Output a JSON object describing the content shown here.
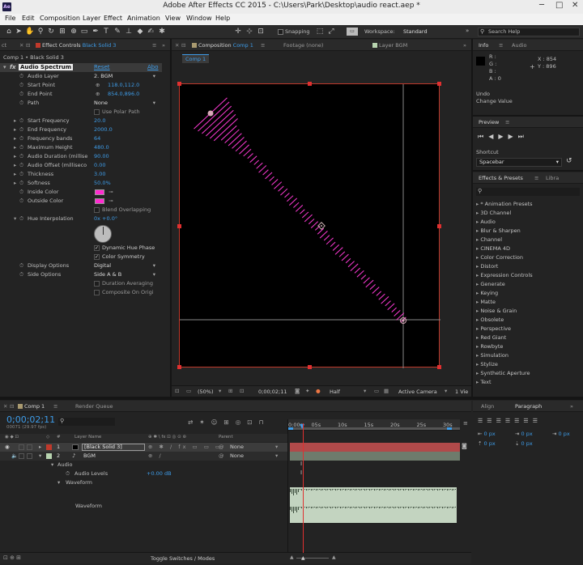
{
  "window": {
    "title": "Adobe After Effects CC 2015 - C:\\Users\\Park\\Desktop\\audio react.aep *",
    "app_icon": "Ae"
  },
  "menu": [
    "File",
    "Edit",
    "Composition",
    "Layer",
    "Effect",
    "Animation",
    "View",
    "Window",
    "Help"
  ],
  "toolbar": {
    "snapping_label": "Snapping",
    "workspace_label": "Workspace:",
    "workspace_value": "Standard",
    "search_placeholder": "Search Help"
  },
  "effect_controls": {
    "tab_prev": "ct",
    "tab_label": "Effect Controls",
    "tab_layer": "Black Solid 3",
    "breadcrumb": "Comp 1 • Black Solid 3",
    "effect_name": "Audio Spectrum",
    "reset_label": "Reset",
    "about_label": "Abo",
    "rows": [
      {
        "label": "Audio Layer",
        "value": "2. BGM",
        "type": "dropdown"
      },
      {
        "label": "Start Point",
        "value": "118.0,112.0",
        "type": "point"
      },
      {
        "label": "End Point",
        "value": "854.0,896.0",
        "type": "point"
      },
      {
        "label": "Path",
        "value": "None",
        "type": "dropdown"
      },
      {
        "label": "",
        "value": "Use Polar Path",
        "type": "check"
      },
      {
        "label": "Start Frequency",
        "value": "20.0",
        "type": "num"
      },
      {
        "label": "End Frequency",
        "value": "2000.0",
        "type": "num"
      },
      {
        "label": "Frequency bands",
        "value": "64",
        "type": "num"
      },
      {
        "label": "Maximum Height",
        "value": "480.0",
        "type": "num"
      },
      {
        "label": "Audio Duration (millise",
        "value": "90.00",
        "type": "num"
      },
      {
        "label": "Audio Offset (milliseco",
        "value": "0.00",
        "type": "num"
      },
      {
        "label": "Thickness",
        "value": "3.00",
        "type": "num"
      },
      {
        "label": "Softness",
        "value": "50.0%",
        "type": "num"
      },
      {
        "label": "Inside Color",
        "value": "",
        "type": "color"
      },
      {
        "label": "Outside Color",
        "value": "",
        "type": "color"
      },
      {
        "label": "",
        "value": "Blend Overlapping",
        "type": "check"
      },
      {
        "label": "Hue Interpolation",
        "value": "0x +0.0°",
        "type": "num"
      },
      {
        "label": "",
        "value": "Dynamic Hue Phase",
        "type": "check-on"
      },
      {
        "label": "",
        "value": "Color Symmetry",
        "type": "check-on"
      },
      {
        "label": "Display Options",
        "value": "Digital",
        "type": "dropdown"
      },
      {
        "label": "Side Options",
        "value": "Side A & B",
        "type": "dropdown"
      },
      {
        "label": "",
        "value": "Duration Averaging",
        "type": "check"
      },
      {
        "label": "",
        "value": "Composite On Origi",
        "type": "check"
      }
    ],
    "colors": {
      "inside": "#ff2bd0",
      "outside": "#ff2bd0"
    }
  },
  "composition": {
    "tab_label": "Composition",
    "tab_comp": "Comp 1",
    "footage_tab": "Footage (none)",
    "layer_tab": "Layer BGM",
    "sub_tab": "Comp 1",
    "spectrum_color": "#ff3ad6",
    "zoom": "(50%)",
    "timecode": "0;00;02;11",
    "resolution": "Half",
    "camera": "Active Camera",
    "view": "1 Vie"
  },
  "info": {
    "tab_info": "Info",
    "tab_audio": "Audio",
    "r": "R :",
    "g": "G :",
    "b": "B :",
    "a": "A : 0",
    "x": "X : 854",
    "y": "Y : 896",
    "undo_label": "Undo",
    "undo_action": "Change Value"
  },
  "preview": {
    "tab": "Preview",
    "shortcut_label": "Shortcut",
    "shortcut_value": "Spacebar"
  },
  "effects_presets": {
    "tab": "Effects & Presets",
    "tab2": "Libra",
    "items": [
      "* Animation Presets",
      "3D Channel",
      "Audio",
      "Blur & Sharpen",
      "Channel",
      "CINEMA 4D",
      "Color Correction",
      "Distort",
      "Expression Controls",
      "Generate",
      "Keying",
      "Matte",
      "Noise & Grain",
      "Obsolete",
      "Perspective",
      "Red Giant",
      "Rowbyte",
      "Simulation",
      "Stylize",
      "Synthetic Aperture",
      "Text"
    ]
  },
  "timeline": {
    "tab_comp": "Comp 1",
    "tab_render": "Render Queue",
    "timecode": "0;00;02;11",
    "frames": "00071 (29.97 fps)",
    "col_hash": "#",
    "col_layer": "Layer Name",
    "col_parent": "Parent",
    "ruler": [
      "0:00s",
      "05s",
      "10s",
      "15s",
      "20s",
      "25s",
      "30s"
    ],
    "layers": [
      {
        "num": "1",
        "name": "[Black Solid 3]",
        "parent": "None",
        "color": "#c0392b"
      },
      {
        "num": "2",
        "name": "BGM",
        "parent": "None",
        "color": "#6d8a6a"
      }
    ],
    "audio_label": "Audio",
    "audio_levels_label": "Audio Levels",
    "audio_levels_value": "+0.00 dB",
    "waveform_group": "Waveform",
    "waveform_label": "Waveform",
    "toggle_label": "Toggle Switches / Modes"
  },
  "paragraph": {
    "tab_align": "Align",
    "tab_paragraph": "Paragraph",
    "fields": [
      "0 px",
      "0 px",
      "0 px",
      "0 px",
      "0 px"
    ]
  }
}
